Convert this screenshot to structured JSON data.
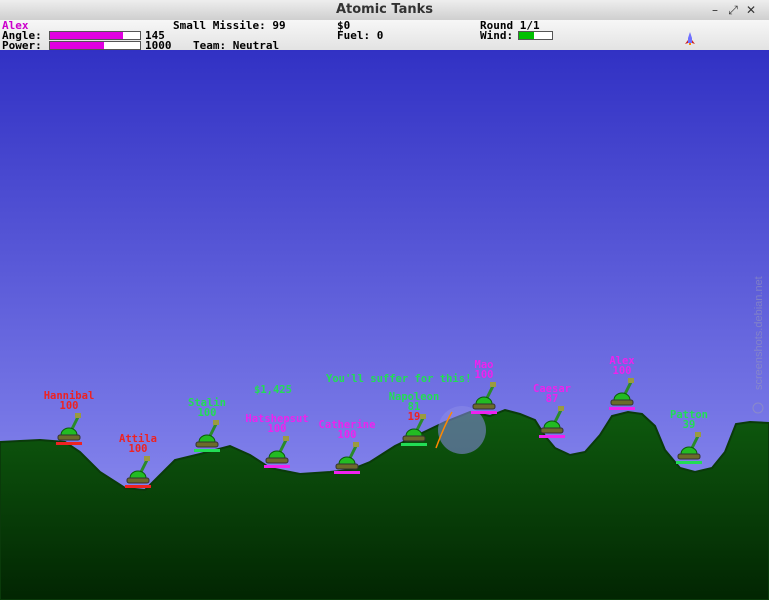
{
  "window": {
    "title": "Atomic Tanks"
  },
  "hud": {
    "player_name": "Alex",
    "angle_label": "Angle:",
    "angle_value": "145",
    "angle_fraction": 0.81,
    "power_label": "Power:",
    "power_value": "1000",
    "power_fraction": 0.6,
    "weapon_text": "Small Missile: 99",
    "team_text": "Team: Neutral",
    "money_text": "$0",
    "fuel_text": "Fuel: 0",
    "round_text": "Round 1/1",
    "wind_label": "Wind:",
    "wind_fraction": 0.45
  },
  "messages": {
    "taunt": "You'll suffer for this!",
    "money_award": "$1,425"
  },
  "colors": {
    "sky_top": "#3131c4",
    "sky_bottom": "#9898f6",
    "ground_light": "#0e5a0e",
    "ground_dark": "#022502",
    "red": "#ee2222",
    "green": "#22dd55",
    "magenta": "#ee22ee",
    "gauge": "#e000e0"
  },
  "tanks": [
    {
      "name": "Hannibal",
      "health": "100",
      "color": "red"
    },
    {
      "name": "Attila",
      "health": "100",
      "color": "red"
    },
    {
      "name": "Stalin",
      "health": "100",
      "color": "green"
    },
    {
      "name": "Hatshepsut",
      "health": "100",
      "color": "magenta"
    },
    {
      "name": "Catherine",
      "health": "100",
      "color": "magenta"
    },
    {
      "name": "Napoleon",
      "health": "81",
      "color": "green",
      "damage": "19"
    },
    {
      "name": "Mao",
      "health": "100",
      "color": "magenta"
    },
    {
      "name": "Caesar",
      "health": "87",
      "color": "magenta"
    },
    {
      "name": "Alex",
      "health": "100",
      "color": "magenta"
    },
    {
      "name": "Patton",
      "health": "39",
      "color": "green"
    }
  ],
  "watermark": "screenshots.debian.net"
}
